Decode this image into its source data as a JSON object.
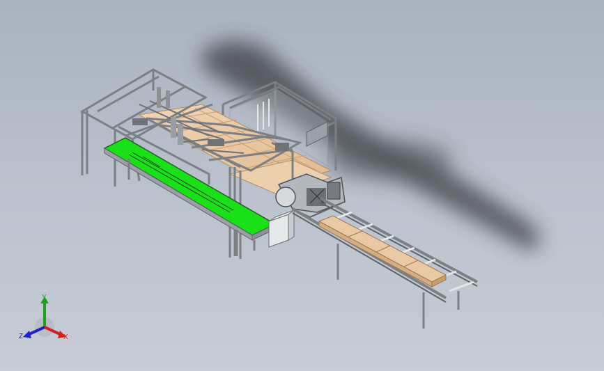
{
  "triad": {
    "x_label": "X",
    "y_label": "Y",
    "z_label": "Z",
    "x_color": "#d21f1f",
    "y_color": "#1aa31a",
    "z_color": "#2222c8"
  },
  "colors": {
    "background_top": "#a9b2bf",
    "background_bottom": "#c7ccd5",
    "frame": "#7c7f84",
    "wood": "#e9c9a4",
    "belt": "#19e019",
    "shadow": "#3a3e44"
  }
}
